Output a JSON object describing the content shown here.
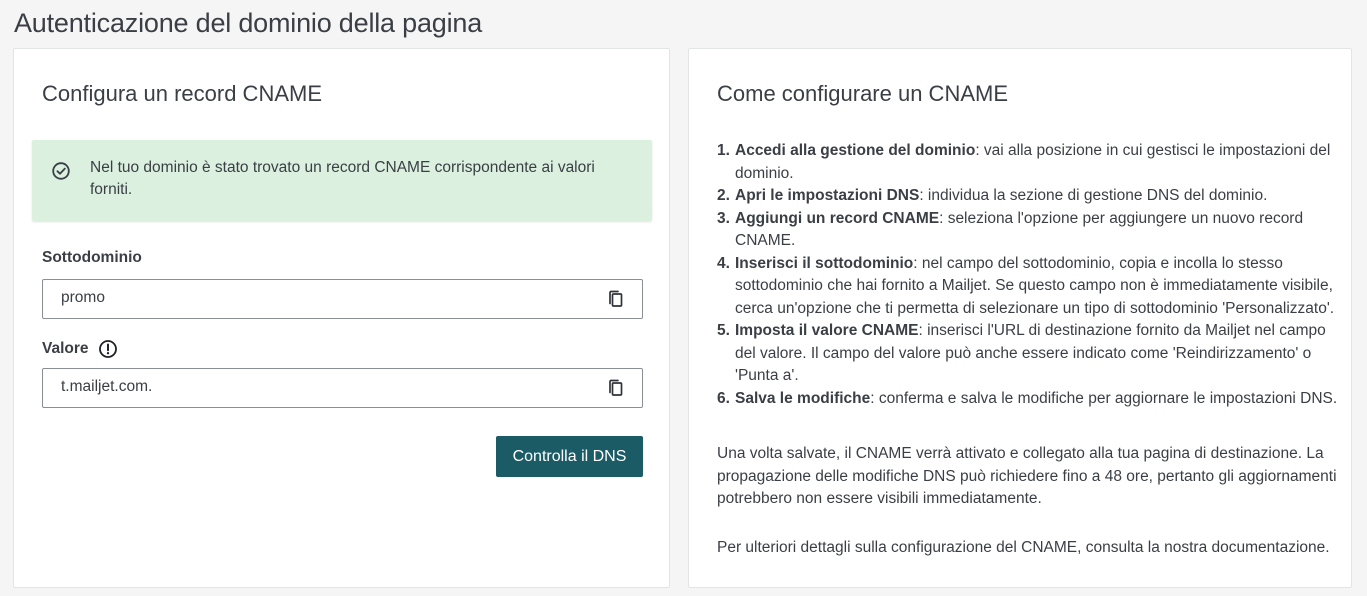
{
  "page": {
    "title": "Autenticazione del dominio della pagina"
  },
  "left_card": {
    "title": "Configura un record CNAME",
    "alert": {
      "icon": "check-circle-icon",
      "text": "Nel tuo dominio è stato trovato un record CNAME corrispondente ai valori forniti."
    },
    "subdomain": {
      "label": "Sottodominio",
      "value": "promo",
      "copy_icon": "copy-icon"
    },
    "value_field": {
      "label": "Valore",
      "info_icon": "exclamation-circle-icon",
      "value": "t.mailjet.com.",
      "copy_icon": "copy-icon"
    },
    "check_button": "Controlla il DNS"
  },
  "right_card": {
    "title": "Come configurare un CNAME",
    "steps": [
      {
        "num": "1.",
        "bold": "Accedi alla gestione del dominio",
        "text": ": vai alla posizione in cui gestisci le impostazioni del dominio."
      },
      {
        "num": "2.",
        "bold": "Apri le impostazioni DNS",
        "text": ": individua la sezione di gestione DNS del dominio."
      },
      {
        "num": "3.",
        "bold": "Aggiungi un record CNAME",
        "text": ": seleziona l'opzione per aggiungere un nuovo record CNAME."
      },
      {
        "num": "4.",
        "bold": "Inserisci il sottodominio",
        "text": ": nel campo del sottodominio, copia e incolla lo stesso sottodominio che hai fornito a Mailjet. Se questo campo non è immediatamente visibile, cerca un'opzione che ti permetta di selezionare un tipo di sottodominio 'Personalizzato'."
      },
      {
        "num": "5.",
        "bold": "Imposta il valore CNAME",
        "text": ": inserisci l'URL di destinazione fornito da Mailjet nel campo del valore. Il campo del valore può anche essere indicato come 'Reindirizzamento' o 'Punta a'."
      },
      {
        "num": "6.",
        "bold": "Salva le modifiche",
        "text": ": conferma e salva le modifiche per aggiornare le impostazioni DNS."
      }
    ],
    "paragraph_1": "Una volta salvate, il CNAME verrà attivato e collegato alla tua pagina di destinazione. La propagazione delle modifiche DNS può richiedere fino a 48 ore, pertanto gli aggiornamenti potrebbero non essere visibili immediatamente.",
    "paragraph_2": "Per ulteriori dettagli sulla configurazione del CNAME, consulta la nostra documentazione."
  },
  "colors": {
    "primary_button": "#1b5b66",
    "success_bg": "#dbf0df"
  }
}
